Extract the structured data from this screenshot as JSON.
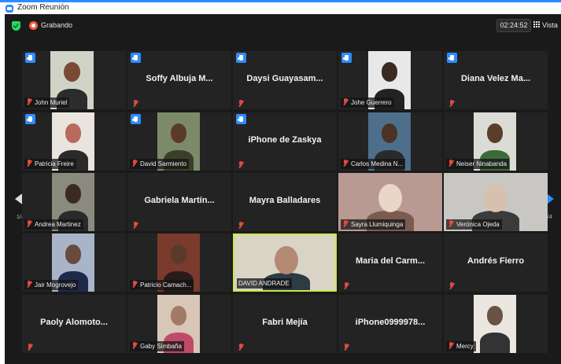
{
  "window": {
    "title": "Zoom Reunión"
  },
  "topbar": {
    "recording_label": "Grabando",
    "timer": "02:24:52",
    "view_label": "Vista"
  },
  "pagination": {
    "left": "1/4",
    "right": "1/4"
  },
  "colors": {
    "accent": "#2d8cff",
    "active_speaker": "#c8e84a",
    "muted": "#e24a3c",
    "recording": "#f35b45",
    "secure": "#23d962"
  },
  "participants": [
    {
      "name": "John Muriel",
      "video": true,
      "hand": true
    },
    {
      "name": "Soffy  Albuja  M...",
      "video": false,
      "hand": true
    },
    {
      "name": "Daysi  Guayasam...",
      "video": false,
      "hand": true
    },
    {
      "name": "Johe Guerrero",
      "video": true,
      "hand": true
    },
    {
      "name": "Diana  Velez  Ma...",
      "video": false,
      "hand": true
    },
    {
      "name": "Patricia Freire",
      "video": true,
      "hand": true
    },
    {
      "name": "David Sarmiento",
      "video": true,
      "hand": true
    },
    {
      "name": "iPhone de Zaskya",
      "video": false,
      "hand": true
    },
    {
      "name": "Carlos Medina N...",
      "video": true,
      "hand": false
    },
    {
      "name": "Neiser Ninabanda",
      "video": true,
      "hand": false
    },
    {
      "name": "Andrea Martinez",
      "video": true,
      "hand": false
    },
    {
      "name": "Gabriela  Martín...",
      "video": false,
      "hand": false
    },
    {
      "name": "Mayra Balladares",
      "video": false,
      "hand": false
    },
    {
      "name": "Sayra Llumiquinga",
      "video": true,
      "hand": false
    },
    {
      "name": "Verónica Ojeda",
      "video": true,
      "hand": false
    },
    {
      "name": "Jair Mogrovejo",
      "video": true,
      "hand": false
    },
    {
      "name": "Patricio Camach...",
      "video": true,
      "hand": false
    },
    {
      "name": "DAVID ANDRADE",
      "video": true,
      "hand": false,
      "speaking": true
    },
    {
      "name": "Maria  del  Carm...",
      "video": false,
      "hand": false
    },
    {
      "name": "Andrés Fierro",
      "video": false,
      "hand": false
    },
    {
      "name": "Paoly  Alomoto...",
      "video": false,
      "hand": false
    },
    {
      "name": "Gaby Simbaña",
      "video": true,
      "hand": false
    },
    {
      "name": "Fabri Mejía",
      "video": false,
      "hand": false
    },
    {
      "name": "iPhone0999978...",
      "video": false,
      "hand": false
    },
    {
      "name": "Mercy",
      "video": true,
      "hand": false
    }
  ]
}
